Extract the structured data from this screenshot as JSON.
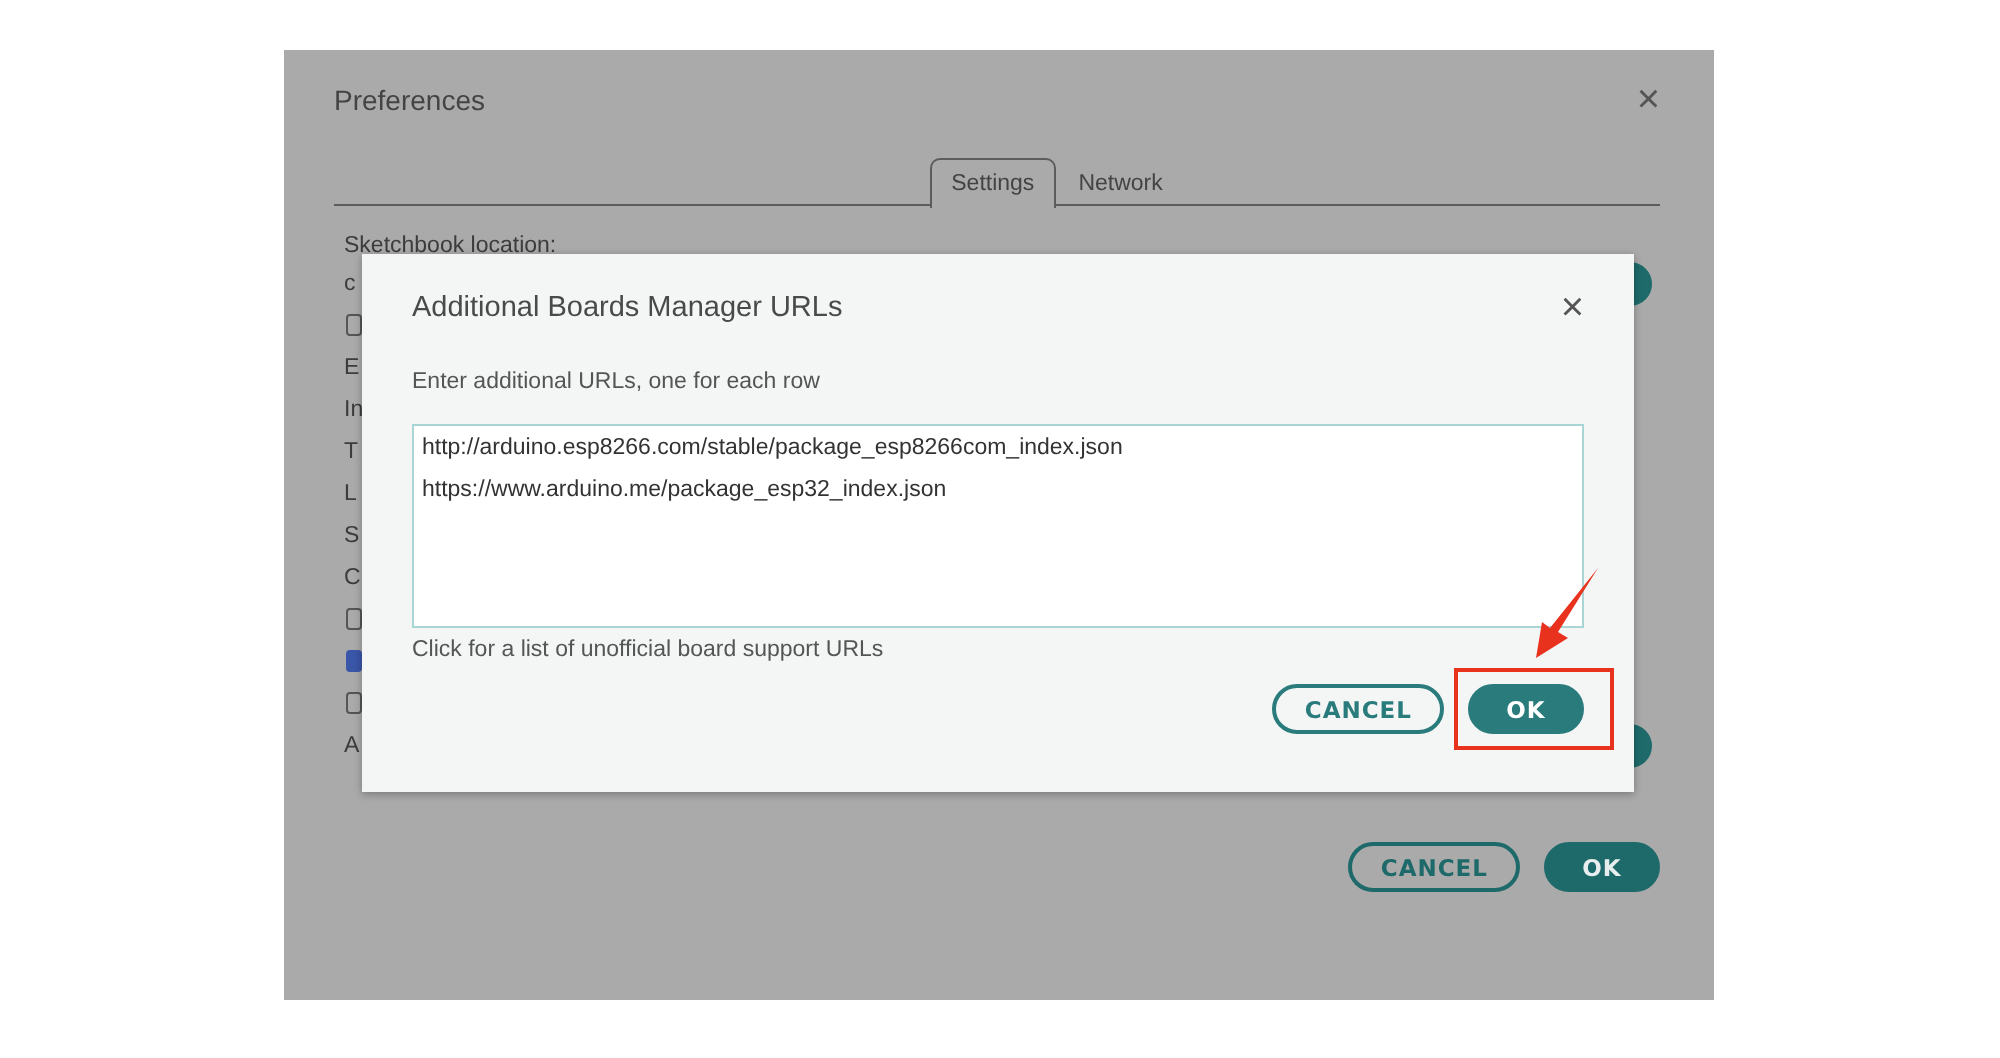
{
  "preferences_window": {
    "title": "Preferences",
    "close": "×",
    "tabs": [
      {
        "label": "Settings",
        "selected": true
      },
      {
        "label": "Network",
        "selected": false
      }
    ],
    "heading": "Sketchbook location:",
    "rows": [
      {
        "kind": "text",
        "text": "c",
        "button": true
      },
      {
        "kind": "checkbox",
        "checked": false
      },
      {
        "kind": "text",
        "text": "E"
      },
      {
        "kind": "text",
        "text": "In"
      },
      {
        "kind": "text",
        "text": "T"
      },
      {
        "kind": "text",
        "text": "L"
      },
      {
        "kind": "text",
        "text": "S"
      },
      {
        "kind": "text",
        "text": "C"
      },
      {
        "kind": "checkbox",
        "checked": false
      },
      {
        "kind": "checkbox",
        "checked": true
      },
      {
        "kind": "checkbox",
        "checked": false
      },
      {
        "kind": "text",
        "text": "A",
        "button": true
      }
    ],
    "buttons": [
      {
        "label": "CANCEL",
        "kind": "outline"
      },
      {
        "label": "OK",
        "kind": "filled"
      }
    ]
  },
  "dialog": {
    "title": "Additional Boards Manager URLs",
    "close": "×",
    "instruction": "Enter additional URLs, one for each row",
    "urls": [
      "http://arduino.esp8266.com/stable/package_esp8266com_index.json",
      "https://www.arduino.me/package_esp32_index.json"
    ],
    "link": "Click for a list of unofficial board support URLs",
    "buttons": [
      {
        "label": "CANCEL",
        "kind": "outline",
        "highlighted": false
      },
      {
        "label": "OK",
        "kind": "filled",
        "highlighted": true
      }
    ]
  }
}
